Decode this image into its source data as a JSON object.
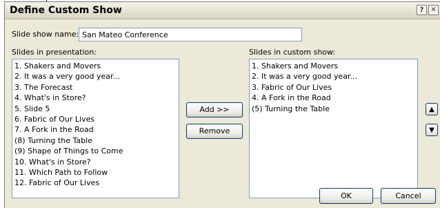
{
  "dialog": {
    "title": "Define Custom Show",
    "help_glyph": "?",
    "close_glyph": "✕"
  },
  "show_name": {
    "label": "Slide show name:",
    "value": "San Mateo Conference"
  },
  "presentation_slides": {
    "label": "Slides in presentation:",
    "items": [
      "1. Shakers and Movers",
      "2. It was a very good year...",
      "3. The Forecast",
      "4. What's in Store?",
      "5. Slide 5",
      "6. Fabric of Our Lives",
      "7. A Fork in the Road",
      "(8) Turning the Table",
      "(9) Shape of Things to Come",
      "10. What's in Store?",
      "11. Which Path to Follow",
      "12. Fabric of Our Lives"
    ]
  },
  "custom_slides": {
    "label": "Slides in custom show:",
    "items": [
      "1. Shakers and Movers",
      "2. It was a very good year...",
      "3. Fabric of Our Lives",
      "4. A Fork in the Road",
      "(5) Turning the Table"
    ]
  },
  "buttons": {
    "add": "Add >>",
    "remove": "Remove",
    "ok": "OK",
    "cancel": "Cancel",
    "move_up_glyph": "▲",
    "move_down_glyph": "▼"
  }
}
